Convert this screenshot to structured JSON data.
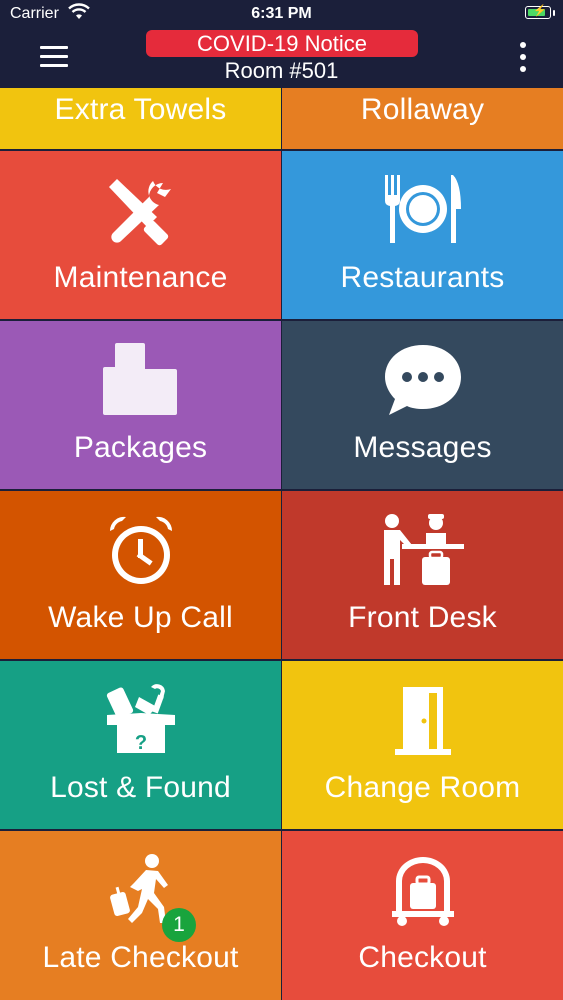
{
  "status_bar": {
    "carrier": "Carrier",
    "time": "6:31 PM"
  },
  "header": {
    "notice": "COVID-19 Notice",
    "room": "Room #501"
  },
  "tiles": {
    "extra_towels": "Extra Towels",
    "rollaway": "Rollaway",
    "maintenance": "Maintenance",
    "restaurants": "Restaurants",
    "packages": "Packages",
    "messages": "Messages",
    "wake_up_call": "Wake Up Call",
    "front_desk": "Front Desk",
    "lost_found": "Lost & Found",
    "change_room": "Change Room",
    "late_checkout": "Late Checkout",
    "checkout": "Checkout"
  },
  "badges": {
    "late_checkout": "1"
  },
  "lost_found_icon_text": "?",
  "icons": {
    "maintenance": "tools-icon",
    "restaurants": "dining-icon",
    "packages": "boxes-icon",
    "messages": "chat-bubble-icon",
    "wake_up_call": "alarm-clock-icon",
    "front_desk": "reception-icon",
    "lost_found": "lost-box-icon",
    "change_room": "door-icon",
    "late_checkout": "walking-traveler-icon",
    "checkout": "luggage-cart-icon"
  },
  "colors": {
    "nav_bg": "#1b1f3a",
    "notice_bg": "#e52b3b",
    "extra_towels": "#f1c40f",
    "rollaway": "#e67e22",
    "maintenance": "#e74c3c",
    "restaurants": "#3498db",
    "packages": "#9b59b6",
    "messages": "#34495e",
    "wake_up_call": "#d35400",
    "front_desk": "#c0392b",
    "lost_found": "#16a085",
    "change_room": "#f1c40f",
    "late_checkout": "#e67e22",
    "checkout": "#e74c3c",
    "badge": "#19a43d"
  }
}
